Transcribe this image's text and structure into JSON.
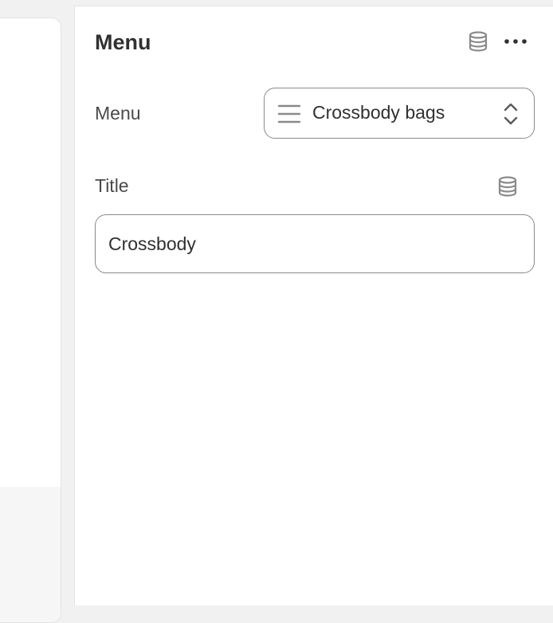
{
  "panel": {
    "title": "Menu",
    "header_icons": [
      "database-icon",
      "more-horizontal-icon"
    ]
  },
  "fields": {
    "menu": {
      "label": "Menu",
      "value": "Crossbody bags",
      "icon": "list-icon"
    },
    "title": {
      "label": "Title",
      "value": "Crossbody",
      "icon": "database-icon"
    }
  },
  "colors": {
    "panel_bg": "#ffffff",
    "canvas_bg": "#f1f1f1",
    "border": "#8a8a8a",
    "text": "#303030",
    "icon": "#8a8a8a"
  }
}
